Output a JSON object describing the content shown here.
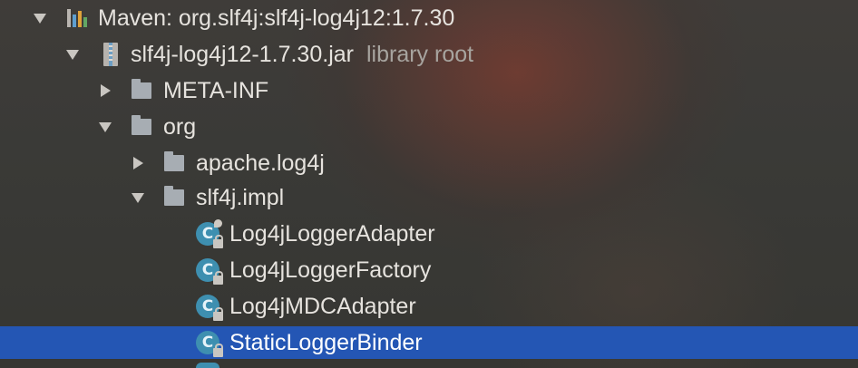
{
  "tree": {
    "maven_library": "Maven: org.slf4j:slf4j-log4j12:1.7.30",
    "jar": "slf4j-log4j12-1.7.30.jar",
    "jar_hint": "library root",
    "meta_inf": "META-INF",
    "org": "org",
    "apache_log4j": "apache.log4j",
    "slf4j_impl": "slf4j.impl",
    "classes": [
      "Log4jLoggerAdapter",
      "Log4jLoggerFactory",
      "Log4jMDCAdapter",
      "StaticLoggerBinder"
    ],
    "class_icon_letter": "C"
  },
  "icons": {
    "expanded": "triangle-down",
    "collapsed": "triangle-right",
    "library": "maven-library",
    "jar": "jar-archive",
    "package": "folder",
    "class": "class-c-badge"
  },
  "colors": {
    "selection": "#2456b4",
    "text": "#e6e3de",
    "hint": "#a7a49f",
    "class_icon": "#3e8fb0",
    "folder": "#a7adb3"
  },
  "selected_item": "StaticLoggerBinder"
}
